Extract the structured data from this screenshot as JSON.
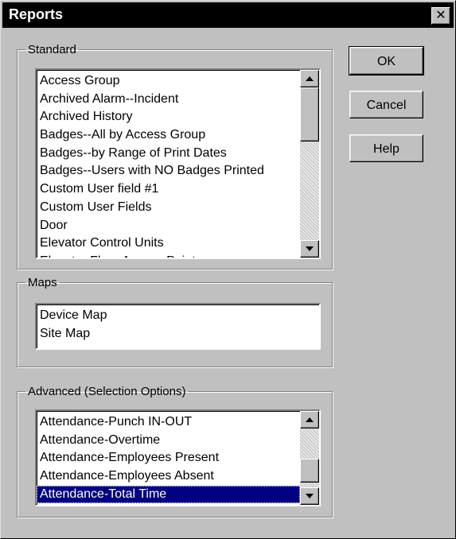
{
  "window": {
    "title": "Reports",
    "close_label": "✕"
  },
  "standard": {
    "label": "Standard",
    "items": [
      "Access Group",
      "Archived Alarm--Incident",
      "Archived History",
      "Badges--All by Access Group",
      "Badges--by Range of Print Dates",
      "Badges--Users with NO Badges Printed",
      "Custom User field #1",
      "Custom User Fields",
      "Door",
      "Elevator Control Units",
      "Elevator Floor Access Point"
    ]
  },
  "maps": {
    "label": "Maps",
    "items": [
      "Device Map",
      "Site Map"
    ]
  },
  "advanced": {
    "label": "Advanced (Selection Options)",
    "items": [
      "Attendance-Punch IN-OUT",
      "Attendance-Overtime",
      "Attendance-Employees Present",
      "Attendance-Employees Absent",
      "Attendance-Total Time"
    ],
    "selected": "Attendance-Total Time"
  },
  "buttons": {
    "ok": "OK",
    "cancel": "Cancel",
    "help": "Help"
  }
}
